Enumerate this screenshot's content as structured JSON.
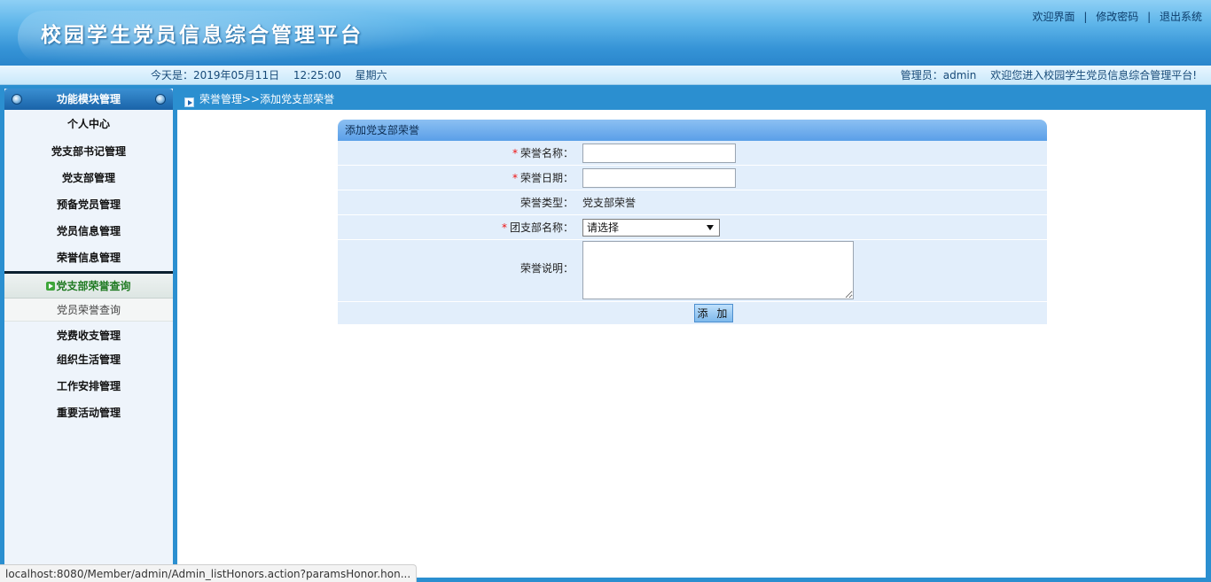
{
  "header": {
    "site_title": "校园学生党员信息综合管理平台",
    "links": [
      "欢迎界面",
      "修改密码",
      "退出系统"
    ],
    "separator": "|"
  },
  "infobar": {
    "date_label": "今天是：2019年05月11日",
    "time": "12:25:00",
    "weekday": "星期六",
    "admin_label": "管理员：admin",
    "welcome": "欢迎您进入校园学生党员信息综合管理平台!"
  },
  "sidebar": {
    "title": "功能模块管理",
    "items_before": [
      "个人中心",
      "党支部书记管理",
      "党支部管理",
      "预备党员管理",
      "党员信息管理",
      "荣誉信息管理"
    ],
    "submenu": {
      "active": "党支部荣誉查询",
      "other": "党员荣誉查询"
    },
    "items_after": [
      "党费收支管理",
      "组织生活管理",
      "工作安排管理",
      "重要活动管理"
    ]
  },
  "breadcrumb": "荣誉管理>>添加党支部荣誉",
  "form": {
    "title": "添加党支部荣誉",
    "required_mark": "*",
    "honor_name_label": "荣誉名称：",
    "honor_name_value": "",
    "honor_date_label": "荣誉日期：",
    "honor_date_value": "",
    "honor_type_label": "荣誉类型：",
    "honor_type_value": "党支部荣誉",
    "branch_label": "团支部名称：",
    "branch_selected": "请选择",
    "desc_label": "荣誉说明：",
    "desc_value": "",
    "submit_label": "添 加"
  },
  "statusbar": {
    "url": "localhost:8080/Member/admin/Admin_listHonors.action?paramsHonor.hon..."
  },
  "colors": {
    "header_blue": "#3593d6",
    "frame_blue": "#2b8fd0",
    "form_row_bg": "#e2eefb",
    "active_submenu_text": "#1f7a22",
    "required_red": "#e11"
  }
}
